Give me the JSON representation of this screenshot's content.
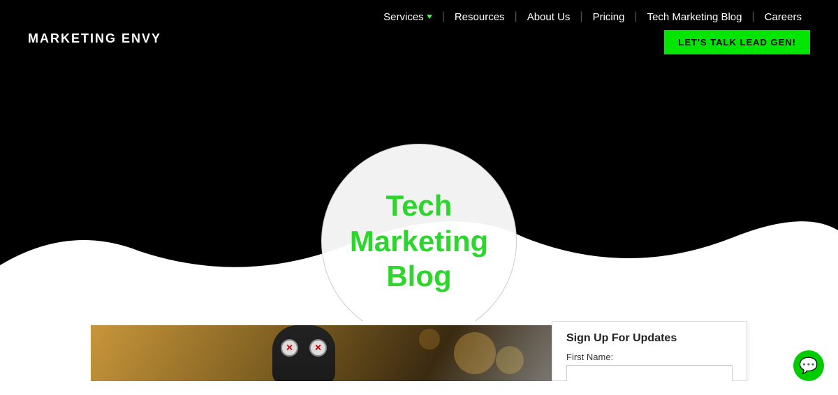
{
  "header": {
    "logo": "MARKETING  ENVY",
    "nav": {
      "items": [
        {
          "label": "Services",
          "hasDropdown": true
        },
        {
          "label": "Resources"
        },
        {
          "label": "About Us"
        },
        {
          "label": "Pricing"
        },
        {
          "label": "Tech Marketing Blog"
        },
        {
          "label": "Careers"
        }
      ],
      "cta": "LET'S TALK LEAD GEN!"
    }
  },
  "hero": {
    "title_line1": "Tech",
    "title_line2": "Marketing Blog"
  },
  "signup": {
    "title": "Sign Up For Updates",
    "first_name_label": "First Name:",
    "first_name_placeholder": ""
  },
  "chat": {
    "icon": "💬"
  },
  "colors": {
    "green": "#2dd62d",
    "bright_green": "#00e600",
    "black": "#000000",
    "white": "#ffffff"
  }
}
